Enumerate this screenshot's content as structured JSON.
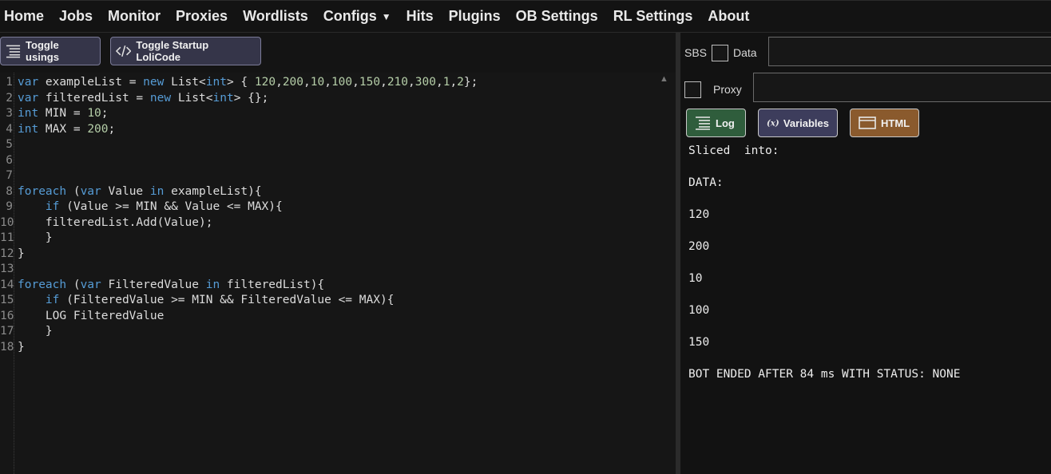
{
  "nav": {
    "items": [
      "Home",
      "Jobs",
      "Monitor",
      "Proxies",
      "Wordlists",
      "Configs",
      "Hits",
      "Plugins",
      "OB Settings",
      "RL Settings",
      "About"
    ]
  },
  "toolbar": {
    "toggle_usings": "Toggle usings",
    "toggle_startup": "Toggle Startup LoliCode"
  },
  "editor": {
    "line_numbers": [
      "1",
      "2",
      "3",
      "4",
      "5",
      "6",
      "7",
      "8",
      "9",
      "10",
      "11",
      "12",
      "13",
      "14",
      "15",
      "16",
      "17",
      "18"
    ]
  },
  "debugger": {
    "sbs_label": "SBS",
    "data_label": "Data",
    "data_value": "",
    "proxy_label": "Proxy",
    "proxy_value": "",
    "tabs": {
      "log": "Log",
      "variables": "Variables",
      "html": "HTML"
    },
    "log_lines": [
      "Sliced  into:",
      "DATA:",
      "120",
      "200",
      "10",
      "100",
      "150",
      "BOT ENDED AFTER 84 ms WITH STATUS: NONE"
    ]
  },
  "colors": {
    "keyword": "#569cd6",
    "number": "#b5cea8",
    "log_tab": "#2f5d3c",
    "variables_tab": "#3d3d5c",
    "html_tab": "#8a5a2d"
  }
}
